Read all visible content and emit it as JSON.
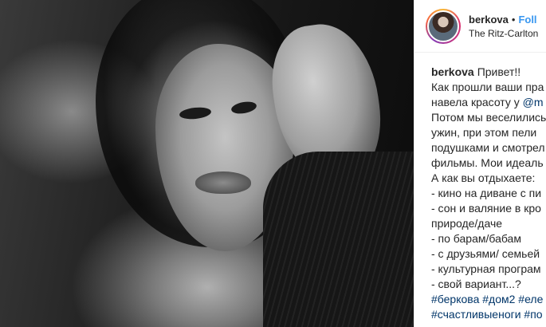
{
  "post": {
    "username": "berkova",
    "separator": "•",
    "follow_label": "Foll",
    "location": "The Ritz-Carlton"
  },
  "caption": {
    "username": "berkova",
    "first_text": "Привет!!",
    "lines": [
      {
        "text": "Как прошли ваши пра"
      },
      {
        "prefix": "навела красоту у ",
        "link": "@m"
      },
      {
        "text": "Потом мы веселились"
      },
      {
        "text": "ужин, при этом пели"
      },
      {
        "text": "подушками и смотрел"
      },
      {
        "text": "фильмы. Мои идеаль"
      },
      {
        "text": "А как вы отдыхаете:"
      },
      {
        "text": "- кино на диване с пи"
      },
      {
        "text": "- сон и валяние в кро"
      },
      {
        "text": "природе/даче"
      },
      {
        "text": "- по барам/бабам"
      },
      {
        "text": "- с друзьями/ семьей"
      },
      {
        "text": "- культурная програм"
      },
      {
        "text": "- свой вариант...?"
      }
    ],
    "hashtags": [
      "#беркова #дом2 #еле",
      "#счастливыеноги #по"
    ]
  },
  "colors": {
    "link": "#003569",
    "follow": "#3897f0",
    "text": "#262626"
  }
}
